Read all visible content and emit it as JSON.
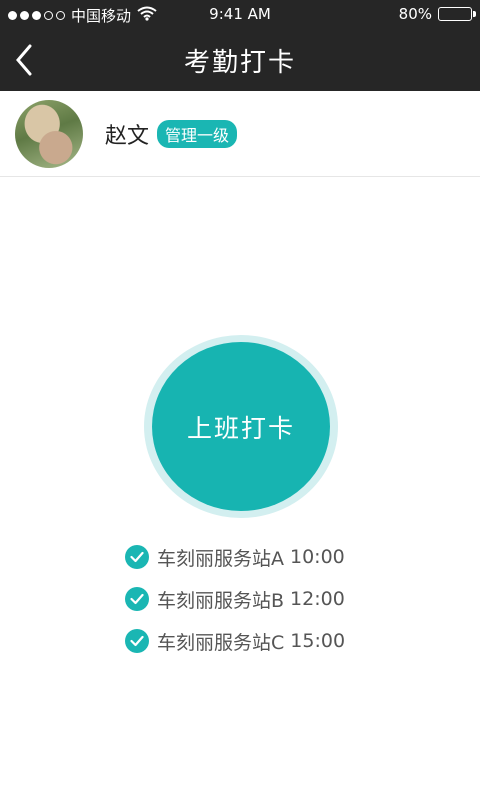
{
  "status_bar": {
    "carrier": "中国移动",
    "time": "9:41 AM",
    "battery": "80%",
    "battery_level": 0.8,
    "signal_bars": 3,
    "signal_total": 5
  },
  "nav": {
    "title": "考勤打卡",
    "back_icon": "chevron-left-icon"
  },
  "user": {
    "name": "赵文",
    "role": "管理一级"
  },
  "punch_button": {
    "label": "上班打卡",
    "color": "#17b4b1"
  },
  "stations": [
    {
      "name": "车刻丽服务站A",
      "time": "10:00"
    },
    {
      "name": "车刻丽服务站B",
      "time": "12:00"
    },
    {
      "name": "车刻丽服务站C",
      "time": "15:00"
    }
  ]
}
